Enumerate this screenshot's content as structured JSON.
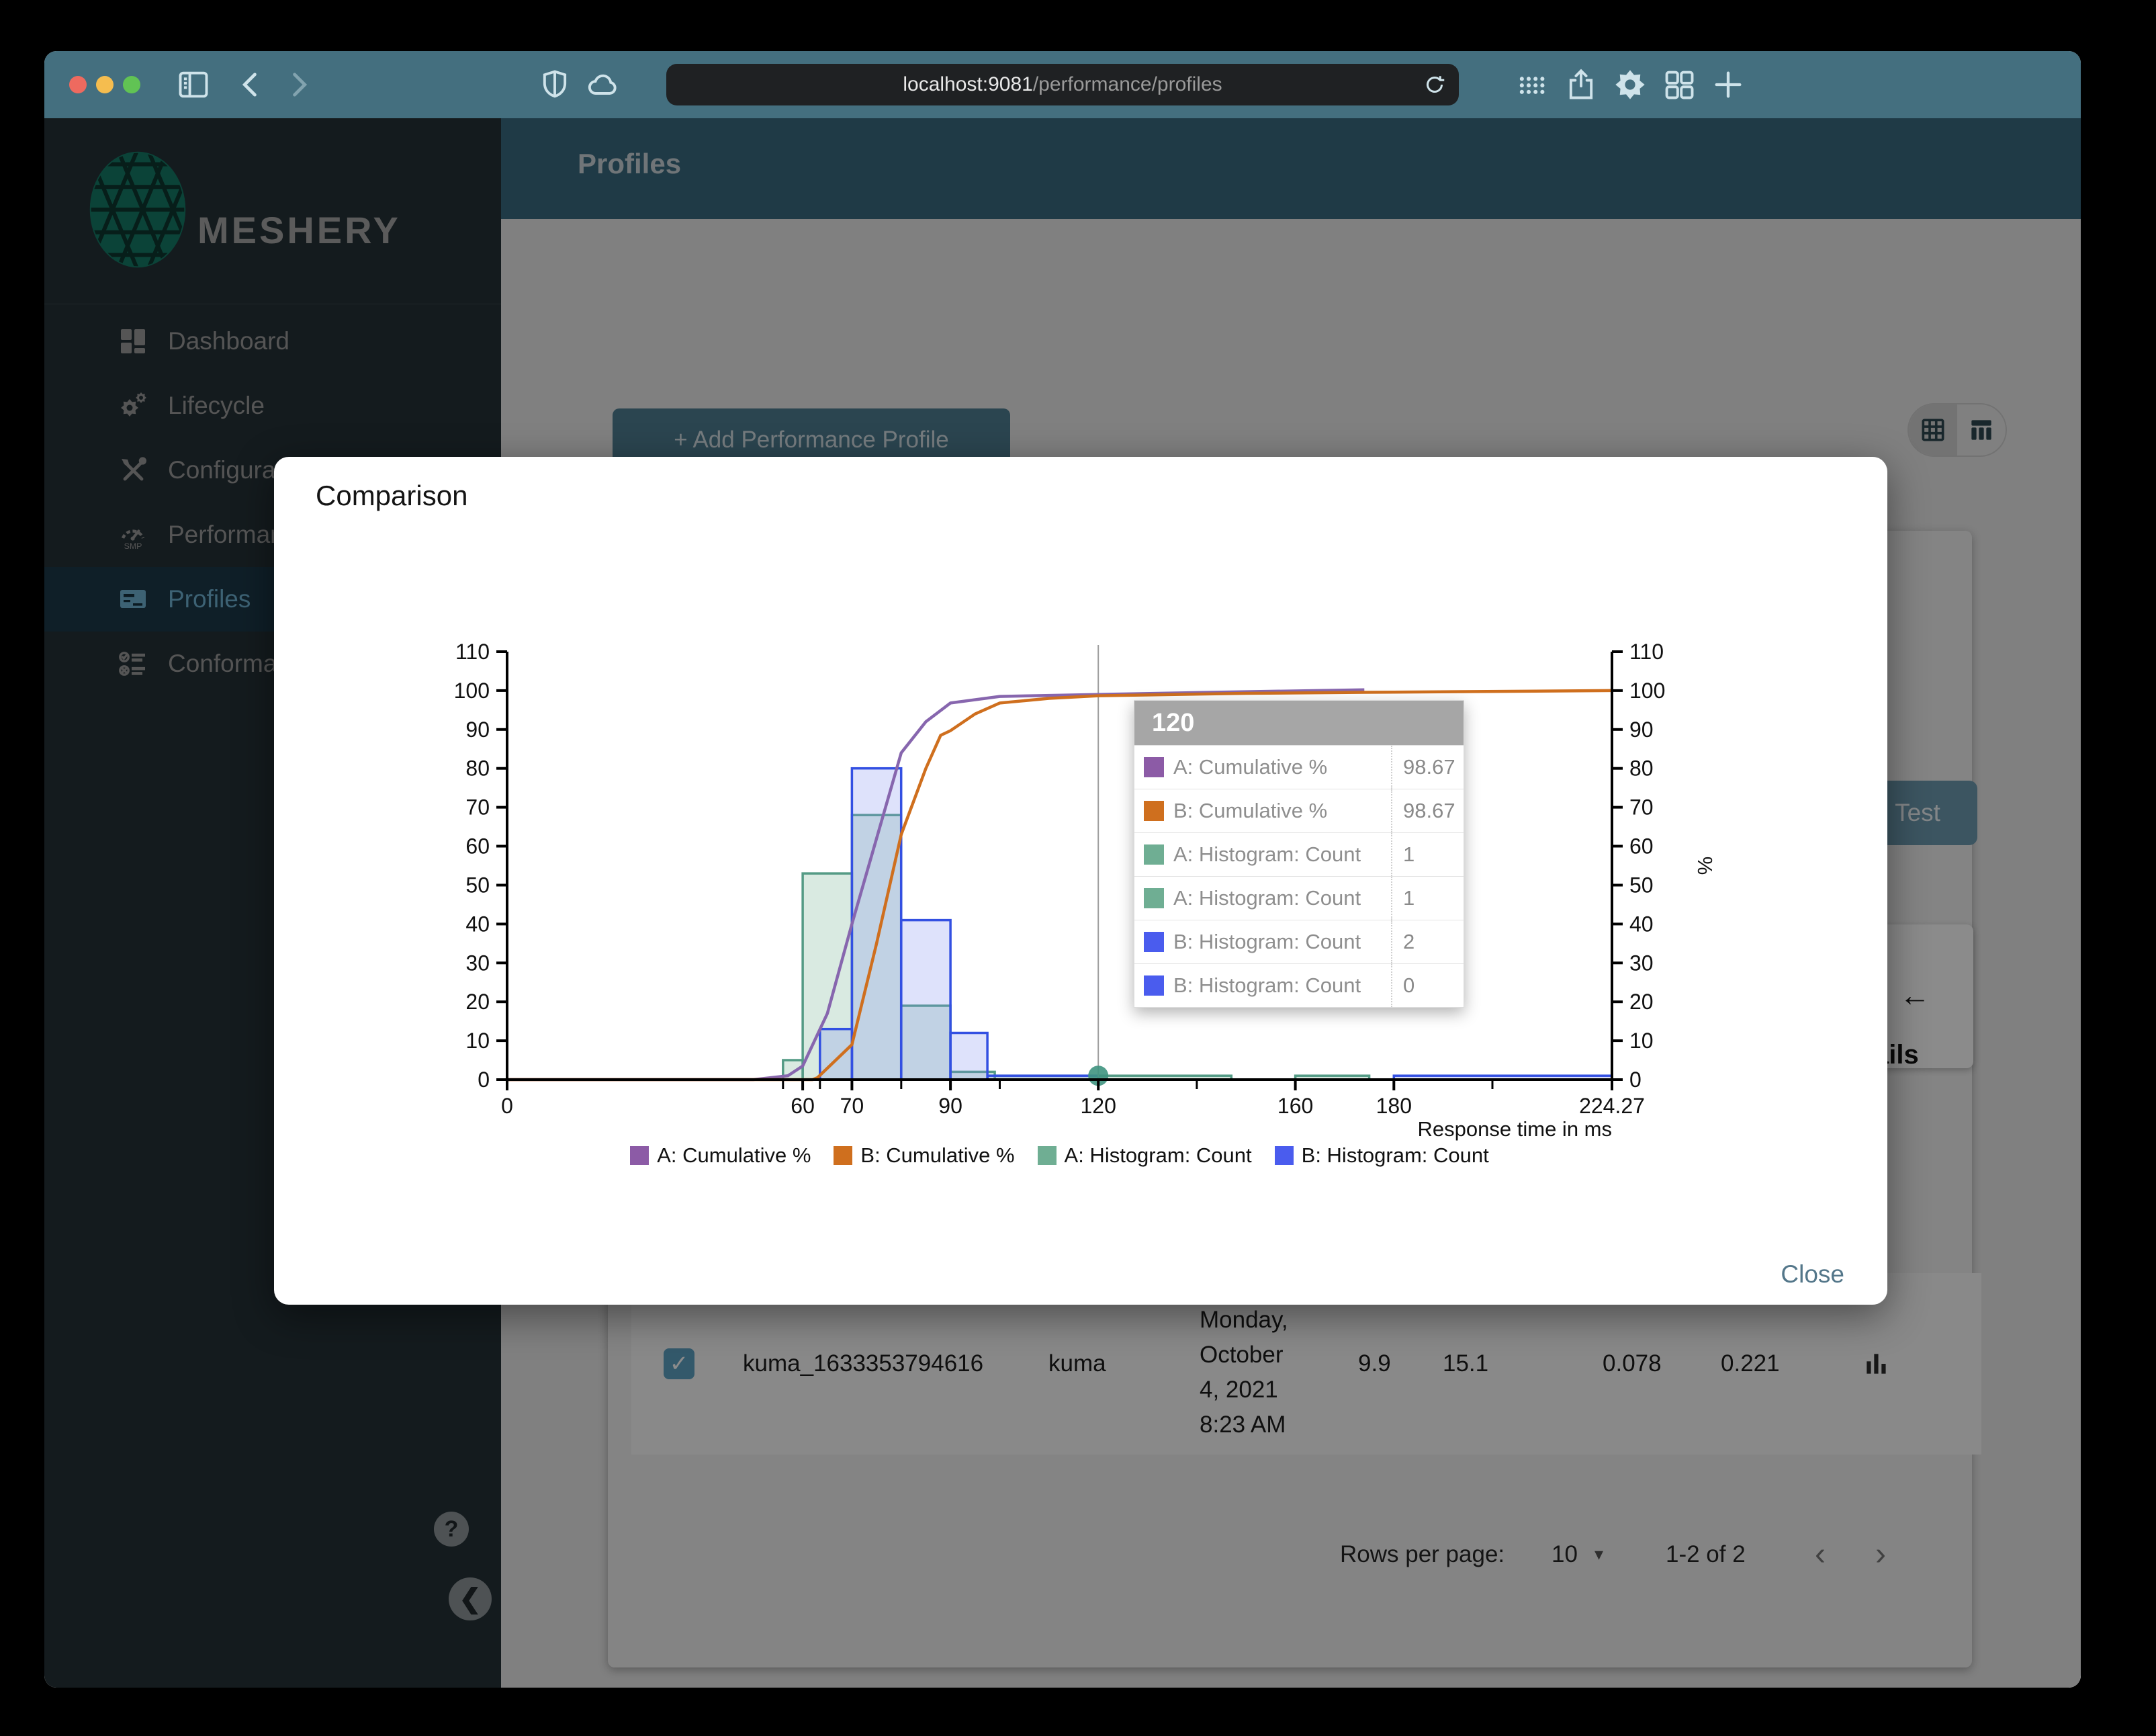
{
  "colors": {
    "brand_green": "#157a66",
    "active_item_blue": "#6fb2d4",
    "close_button_blue": "#54778a",
    "backdrop": "rgba(0,0,0,0.45)"
  },
  "browser": {
    "url_host": "localhost:9081",
    "url_path": "/performance/profiles"
  },
  "sidebar": {
    "brand": "MESHERY",
    "items": [
      {
        "id": "dashboard",
        "label": "Dashboard",
        "active": false
      },
      {
        "id": "lifecycle",
        "label": "Lifecycle",
        "active": false
      },
      {
        "id": "configuration",
        "label": "Configuration",
        "active": false
      },
      {
        "id": "performance",
        "label": "Performance",
        "active": false
      },
      {
        "id": "profiles",
        "label": "Profiles",
        "active": true
      },
      {
        "id": "conformance",
        "label": "Conformance",
        "active": false
      }
    ]
  },
  "appbar": {
    "title": "Profiles"
  },
  "content": {
    "add_button": "+ Add Performance Profile",
    "test_button": "Test",
    "details_fragment": "ails",
    "back_arrow": "←",
    "row": {
      "name": "kuma_1633353794616",
      "mesh": "kuma",
      "date_lines": [
        "Monday,",
        "October",
        "4, 2021",
        "8:23 AM"
      ],
      "qps": "9.9",
      "duration": "15.1",
      "p50": "0.078",
      "p99": "0.221"
    },
    "pagination": {
      "label": "Rows per page:",
      "value": "10",
      "range": "1-2 of 2",
      "prev": "‹",
      "next": "›"
    }
  },
  "modal": {
    "title": "Comparison",
    "close": "Close"
  },
  "chart_data": {
    "type": "mixed",
    "title": "Comparison",
    "xlabel": "Response time in ms",
    "ylabel_right": "%",
    "xlim": [
      0,
      224.27
    ],
    "ylim": [
      0,
      110
    ],
    "y_ticks": [
      0,
      10,
      20,
      30,
      40,
      50,
      60,
      70,
      80,
      90,
      100,
      110
    ],
    "x_ticks_labeled": [
      [
        0,
        "0"
      ],
      [
        60,
        "60"
      ],
      [
        70,
        "70"
      ],
      [
        90,
        "90"
      ],
      [
        120,
        "120"
      ],
      [
        160,
        "160"
      ],
      [
        180,
        "180"
      ],
      [
        224.27,
        "224.27"
      ]
    ],
    "x_ticks_minor": [
      56,
      63.5,
      80,
      100,
      140,
      200
    ],
    "grid": false,
    "legend_position": "bottom",
    "series": [
      {
        "name": "A: Cumulative %",
        "type": "line",
        "color": "#8766ae",
        "legend_color": "#8c5ba6",
        "points": [
          [
            0,
            0
          ],
          [
            50,
            0
          ],
          [
            57,
            1
          ],
          [
            60,
            3.5
          ],
          [
            65,
            17
          ],
          [
            70,
            40
          ],
          [
            75,
            62
          ],
          [
            80,
            84
          ],
          [
            85,
            92
          ],
          [
            90,
            96.8
          ],
          [
            100,
            98.5
          ],
          [
            120,
            99
          ],
          [
            145,
            99.6
          ],
          [
            174,
            100.2
          ]
        ]
      },
      {
        "name": "B: Cumulative %",
        "type": "line",
        "color": "#cf6f1e",
        "legend_color": "#cf6f1e",
        "points": [
          [
            0,
            0
          ],
          [
            62,
            0
          ],
          [
            63,
            0.5
          ],
          [
            70,
            9
          ],
          [
            75,
            35
          ],
          [
            80,
            63
          ],
          [
            85,
            80
          ],
          [
            88,
            88.5
          ],
          [
            90,
            89.7
          ],
          [
            95,
            94
          ],
          [
            100,
            96.8
          ],
          [
            110,
            98
          ],
          [
            120,
            98.67
          ],
          [
            150,
            99.3
          ],
          [
            180,
            99.6
          ],
          [
            224.27,
            100
          ]
        ]
      },
      {
        "name": "A: Histogram: Count",
        "type": "bar",
        "color": "#549b85",
        "fill": "rgba(118,178,148,0.28)",
        "legend_color": "#6fae93",
        "bins": [
          [
            56,
            60,
            5
          ],
          [
            60,
            70,
            53
          ],
          [
            70,
            80,
            68
          ],
          [
            80,
            90,
            19
          ],
          [
            90,
            99,
            2
          ],
          [
            99,
            147,
            1
          ],
          [
            160,
            175,
            1
          ]
        ]
      },
      {
        "name": "B: Histogram: Count",
        "type": "bar",
        "color": "#3350e2",
        "fill": "rgba(122,138,240,0.25)",
        "legend_color": "#4a5cee",
        "bins": [
          [
            63.5,
            70,
            13
          ],
          [
            70,
            80,
            80
          ],
          [
            80,
            90,
            41
          ],
          [
            90,
            97.5,
            12
          ],
          [
            97.5,
            120,
            1
          ],
          [
            180,
            224.27,
            1
          ]
        ]
      }
    ],
    "crosshair_x": 120,
    "marker": {
      "x": 120,
      "y": 1,
      "color": "#3f9480"
    },
    "tooltip": {
      "header": "120",
      "rows": [
        {
          "swatch": "#8c5ba6",
          "label": "A: Cumulative %",
          "value": "98.67"
        },
        {
          "swatch": "#cf6f1e",
          "label": "B: Cumulative %",
          "value": "98.67"
        },
        {
          "swatch": "#6fae93",
          "label": "A: Histogram: Count",
          "value": "1"
        },
        {
          "swatch": "#6fae93",
          "label": "A: Histogram: Count",
          "value": "1"
        },
        {
          "swatch": "#4a5cee",
          "label": "B: Histogram: Count",
          "value": "2"
        },
        {
          "swatch": "#4a5cee",
          "label": "B: Histogram: Count",
          "value": "0"
        }
      ]
    }
  }
}
